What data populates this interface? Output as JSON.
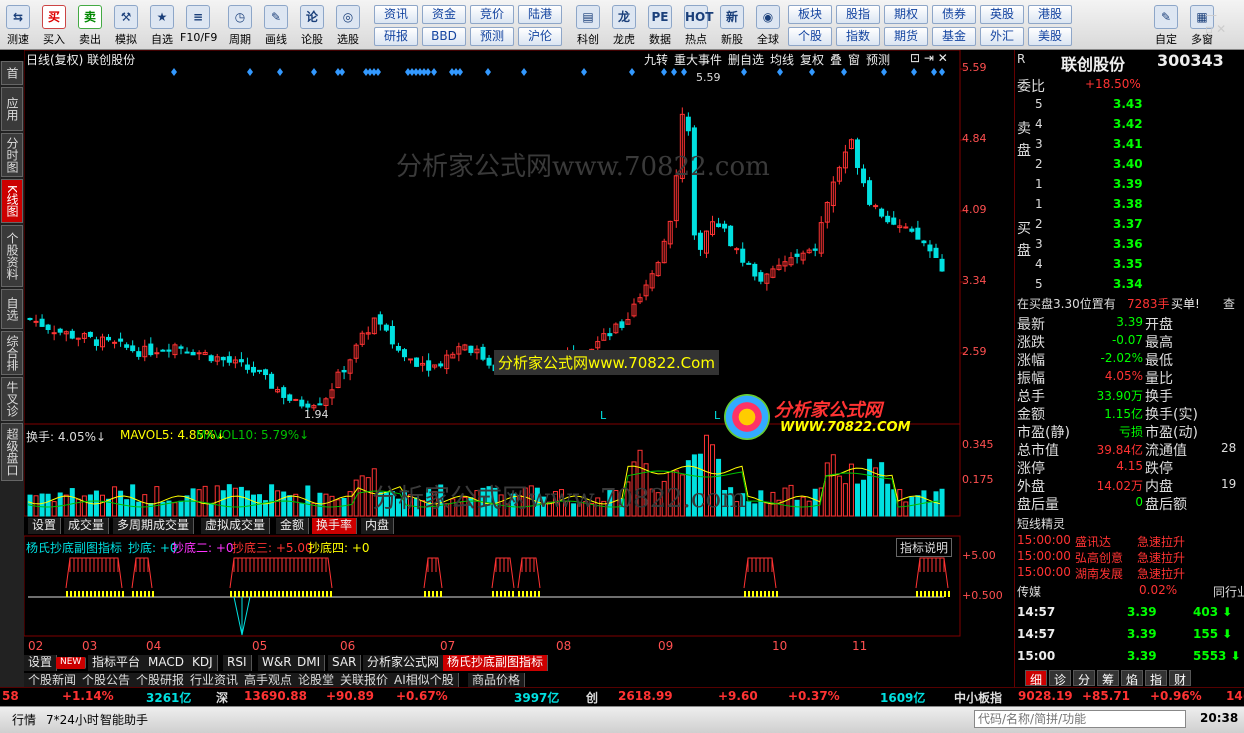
{
  "toolbar": {
    "left": [
      {
        "t": "测速",
        "g": "⇆"
      },
      {
        "t": "买入",
        "g": "买",
        "c": "red"
      },
      {
        "t": "卖出",
        "g": "卖",
        "c": "grn"
      },
      {
        "t": "模拟",
        "g": "⚒"
      },
      {
        "t": "自选",
        "g": "★"
      },
      {
        "t": "F10/F9",
        "g": "≡"
      },
      {
        "t": "周期",
        "g": "◷"
      },
      {
        "t": "画线",
        "g": "✎"
      },
      {
        "t": "论股",
        "g": "论"
      },
      {
        "t": "选股",
        "g": "◎"
      }
    ],
    "pairs": [
      [
        "资讯",
        "研报"
      ],
      [
        "资金",
        "BBD"
      ],
      [
        "竞价",
        "预测"
      ],
      [
        "陆港",
        "沪伦"
      ]
    ],
    "mid": [
      {
        "t": "科创",
        "g": "▤"
      },
      {
        "t": "龙虎",
        "g": "龙"
      },
      {
        "t": "数据",
        "g": "PE"
      },
      {
        "t": "热点",
        "g": "HOT"
      },
      {
        "t": "新股",
        "g": "新"
      },
      {
        "t": "全球",
        "g": "◉"
      }
    ],
    "pairs2": [
      [
        "板块",
        "个股"
      ],
      [
        "股指",
        "指数"
      ],
      [
        "期权",
        "期货"
      ],
      [
        "债券",
        "基金"
      ],
      [
        "英股",
        "外汇"
      ],
      [
        "港股",
        "美股"
      ]
    ],
    "right": [
      {
        "t": "自定",
        "g": "✎"
      },
      {
        "t": "多窗",
        "g": "▦"
      }
    ]
  },
  "lefttabs": [
    "首页",
    "应用",
    "分时图",
    "K线图",
    "个股资料",
    "自选股",
    "综合排名",
    "牛叉诊股",
    "超级盘口"
  ],
  "chart_header": {
    "left": "日线(复权)  联创股份",
    "buttons": [
      "九转",
      "重大事件",
      "删自选",
      "均线",
      "复权",
      "叠",
      "窗",
      "预测"
    ]
  },
  "price_axis": [
    "5.59",
    "4.84",
    "4.09",
    "3.34",
    "2.59"
  ],
  "annot": {
    "high": "5.59",
    "low": "1.94",
    "watermark": "分析家公式网www.70822.com",
    "watermark2": "分析家公式网www.70822.Com",
    "logo": "分析家公式网",
    "logo_url": "WWW.70822.COM",
    "L1": "L",
    "L2": "L"
  },
  "vol_header": {
    "a": "换手: 4.05%↓",
    "b": "MAVOL5: 4.85%↓",
    "c": "MAVOL10: 5.79%↓"
  },
  "vol_axis": [
    "0.345",
    "0.175"
  ],
  "vol_tabs": [
    "设置",
    "成交量",
    "多周期成交量",
    "虚拟成交量",
    "金额",
    "换手率",
    "内盘"
  ],
  "ind_header": {
    "name": "杨氏抄底副图指标",
    "p1": "抄底: +0",
    "p2": "抄底二: +0",
    "p3": "抄底三: +5.00",
    "p4": "抄底四: +0",
    "btn": "指标说明"
  },
  "ind_axis": [
    "+5.00",
    "+0.500"
  ],
  "months": [
    "02",
    "03",
    "04",
    "05",
    "06",
    "07",
    "08",
    "09",
    "10",
    "11"
  ],
  "ind_tabs": [
    "设置",
    "NEW",
    "指标平台",
    "MACD",
    "KDJ",
    "RSI",
    "W&R",
    "DMI",
    "SAR",
    "分析家公式网",
    "杨氏抄底副图指标"
  ],
  "ind_tabs2": [
    "个股新闻",
    "个股公告",
    "个股研报",
    "行业资讯",
    "高手观点",
    "论股堂",
    "关联报价",
    "AI相似个股",
    "商品价格"
  ],
  "rp": {
    "mark": "R",
    "name": "联创股份",
    "code": "300343",
    "weibi_label": "委比",
    "weibi": "+18.50%",
    "sell_label": "卖盘",
    "buy_label": "买盘",
    "asks": [
      [
        "5",
        "3.43"
      ],
      [
        "4",
        "3.42"
      ],
      [
        "3",
        "3.41"
      ],
      [
        "2",
        "3.40"
      ],
      [
        "1",
        "3.39"
      ]
    ],
    "bids": [
      [
        "1",
        "3.38"
      ],
      [
        "2",
        "3.37"
      ],
      [
        "3",
        "3.36"
      ],
      [
        "4",
        "3.35"
      ],
      [
        "5",
        "3.34"
      ]
    ],
    "info_text": "在买盘3.30位置有",
    "info_num": "7283手",
    "info_act": "买单!",
    "info_btn": "查",
    "stats": [
      [
        "最新",
        "3.39",
        "开盘",
        ""
      ],
      [
        "涨跌",
        "-0.07",
        "最高",
        ""
      ],
      [
        "涨幅",
        "-2.02%",
        "最低",
        ""
      ],
      [
        "振幅",
        "4.05%",
        "量比",
        ""
      ],
      [
        "总手",
        "33.90万",
        "换手",
        ""
      ],
      [
        "金额",
        "1.15亿",
        "换手(实)",
        ""
      ],
      [
        "市盈(静)",
        "亏损",
        "市盈(动)",
        ""
      ],
      [
        "总市值",
        "39.84亿",
        "流通值",
        "28"
      ],
      [
        "涨停",
        "4.15",
        "跌停",
        ""
      ],
      [
        "外盘",
        "14.02万",
        "内盘",
        "19"
      ],
      [
        "盘后量",
        "0",
        "盘后额",
        ""
      ]
    ],
    "jl_title": "短线精灵",
    "jl": [
      [
        "15:00:00",
        "盛讯达",
        "急速拉升"
      ],
      [
        "15:00:00",
        "弘高创意",
        "急速拉升"
      ],
      [
        "15:00:00",
        "湖南发展",
        "急速拉升"
      ]
    ],
    "ind_name": "传媒",
    "ind_pct": "0.02%",
    "ind_btn": "同行业",
    "ticks": [
      [
        "14:57",
        "3.39",
        "403"
      ],
      [
        "14:57",
        "3.39",
        "155"
      ],
      [
        "15:00",
        "3.39",
        "5553"
      ]
    ],
    "tabs": [
      "细",
      "诊",
      "分",
      "筹",
      "焰",
      "指",
      "财"
    ]
  },
  "status": {
    "s1": "58",
    "s2": "+1.14%",
    "s3": "3261亿",
    "s4": "深",
    "s5": "13690.88",
    "s6": "+90.89",
    "s7": "+0.67%",
    "s8": "3997亿",
    "s9": "创",
    "s10": "2618.99",
    "s11": "+9.60",
    "s12": "+0.37%",
    "s13": "1609亿",
    "s14": "中小板指",
    "s15": "9028.19",
    "s16": "+85.71",
    "s17": "+0.96%",
    "s18": "14("
  },
  "bottom": {
    "b1": "行情",
    "b2": "7*24小时",
    "b3": "智能助手",
    "search_placeholder": "代码/名称/简拼/功能",
    "time": "20:38"
  },
  "colors": {
    "up": "#ff3333",
    "down": "#00e0e0",
    "grid": "#800000",
    "yellow": "#ffff00"
  }
}
